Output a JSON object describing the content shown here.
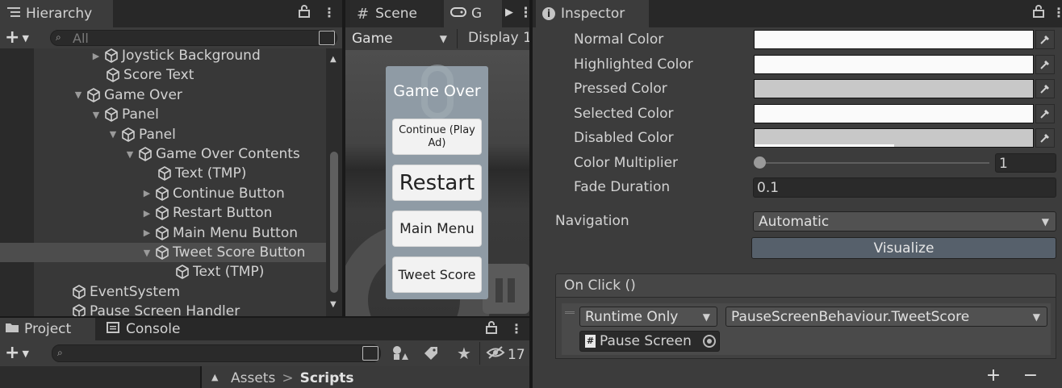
{
  "hierarchy": {
    "tab_label": "Hierarchy",
    "search_placeholder": "All",
    "items": [
      {
        "label": "Joystick Background",
        "arrow": "▶"
      },
      {
        "label": "Score Text",
        "arrow": ""
      },
      {
        "label": "Game Over",
        "arrow": "▼"
      },
      {
        "label": "Panel",
        "arrow": "▼"
      },
      {
        "label": "Panel",
        "arrow": "▼"
      },
      {
        "label": "Game Over Contents",
        "arrow": "▼"
      },
      {
        "label": "Text (TMP)",
        "arrow": ""
      },
      {
        "label": "Continue Button",
        "arrow": "▶"
      },
      {
        "label": "Restart Button",
        "arrow": "▶"
      },
      {
        "label": "Main Menu Button",
        "arrow": "▶"
      },
      {
        "label": "Tweet Score Button",
        "arrow": "▼"
      },
      {
        "label": "Text (TMP)",
        "arrow": ""
      },
      {
        "label": "EventSystem",
        "arrow": ""
      },
      {
        "label": "Pause Screen Handler",
        "arrow": ""
      }
    ]
  },
  "scene": {
    "scene_tab": "Scene",
    "game_tab": "G",
    "game_dropdown": "Game",
    "display_label": "Display 1",
    "panel_title": "Game Over",
    "buttons": {
      "continue": "Continue (Play Ad)",
      "restart": "Restart",
      "main_menu": "Main Menu",
      "tweet": "Tweet Score"
    }
  },
  "project": {
    "project_tab": "Project",
    "console_tab": "Console",
    "hidden_count": "17",
    "breadcrumb_root": "Assets",
    "breadcrumb_separator": ">",
    "breadcrumb_current": "Scripts"
  },
  "inspector": {
    "tab_label": "Inspector",
    "normal_color_label": "Normal Color",
    "highlighted_color_label": "Highlighted Color",
    "pressed_color_label": "Pressed Color",
    "selected_color_label": "Selected Color",
    "disabled_color_label": "Disabled Color",
    "color_multiplier_label": "Color Multiplier",
    "color_multiplier_value": "1",
    "fade_duration_label": "Fade Duration",
    "fade_duration_value": "0.1",
    "navigation_label": "Navigation",
    "navigation_value": "Automatic",
    "visualize_label": "Visualize",
    "on_click_label": "On Click ()",
    "runtime_value": "Runtime Only",
    "function_value": "PauseScreenBehaviour.TweetScore",
    "object_value": "Pause Screen",
    "colors": {
      "normal": "#fafafa",
      "highlighted": "#fafafa",
      "pressed": "#c8c8c8",
      "selected": "#fafafa",
      "disabled": "#c8c8c8"
    }
  }
}
